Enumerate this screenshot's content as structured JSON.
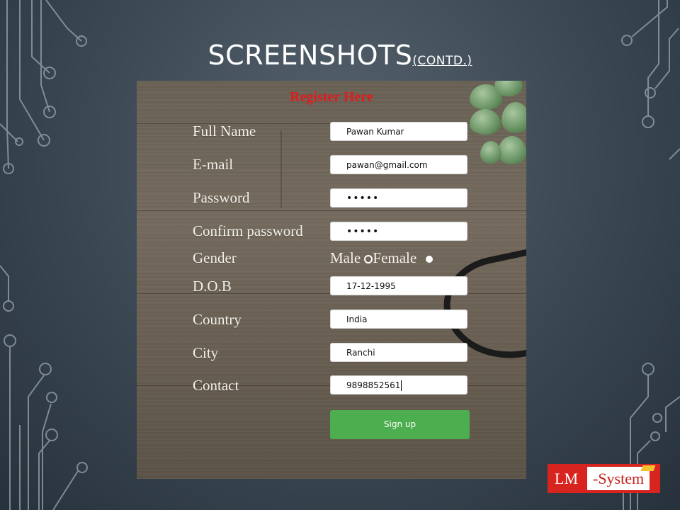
{
  "slide": {
    "title_main": "SCREENSHOTS",
    "title_sub": "(CONTD.)"
  },
  "form": {
    "heading": "Register Here",
    "fields": [
      {
        "label": "Full Name",
        "value": "Pawan Kumar"
      },
      {
        "label": "E-mail",
        "value": "pawan@gmail.com"
      },
      {
        "label": "Password",
        "value": "•••••"
      },
      {
        "label": "Confirm password",
        "value": "•••••"
      },
      {
        "label": "D.O.B",
        "value": "17-12-1995"
      },
      {
        "label": "Country",
        "value": "India"
      },
      {
        "label": "City",
        "value": "Ranchi"
      },
      {
        "label": "Contact",
        "value": "9898852561"
      }
    ],
    "gender": {
      "label": "Gender",
      "options": [
        {
          "label": "Male",
          "selected": false
        },
        {
          "label": "Female",
          "selected": true
        }
      ]
    },
    "submit_label": "Sign up"
  },
  "logo": {
    "part1": "LM",
    "part2": "-System"
  },
  "colors": {
    "heading": "#e01b1b",
    "submit": "#4cae4f",
    "logo": "#d7241f"
  }
}
